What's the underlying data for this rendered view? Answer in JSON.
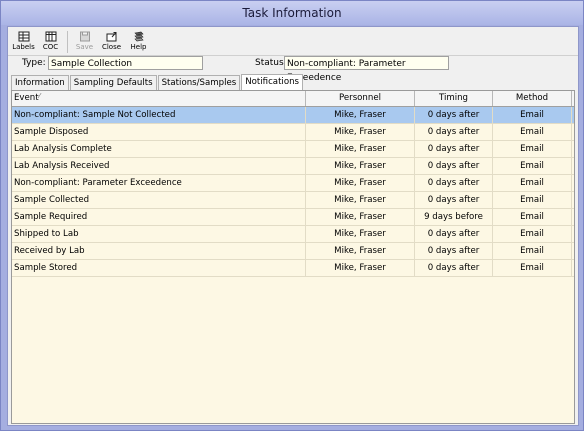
{
  "window": {
    "title": "Task Information"
  },
  "toolbar": {
    "buttons": [
      {
        "label": "Labels",
        "icon": "labels-icon",
        "enabled": true
      },
      {
        "label": "COC",
        "icon": "coc-icon",
        "enabled": true
      },
      {
        "label": "Save",
        "icon": "save-icon",
        "enabled": false
      },
      {
        "label": "Close",
        "icon": "close-icon",
        "enabled": true
      },
      {
        "label": "Help",
        "icon": "help-icon",
        "enabled": true
      }
    ]
  },
  "form": {
    "type_label": "Type:",
    "type_value": "Sample Collection",
    "status_label": "Status:",
    "status_value": "Non-compliant: Parameter Exceedence"
  },
  "tabs": [
    {
      "label": "Information",
      "active": false
    },
    {
      "label": "Sampling Defaults",
      "active": false
    },
    {
      "label": "Stations/Samples",
      "active": false
    },
    {
      "label": "Notifications",
      "active": true
    }
  ],
  "grid": {
    "columns": [
      "Event",
      "Personnel",
      "Timing",
      "Method"
    ],
    "rows": [
      {
        "event": "Non-compliant: Sample Not Collected",
        "personnel": "Mike, Fraser",
        "timing": "0 days after",
        "method": "Email",
        "selected": true
      },
      {
        "event": "Sample Disposed",
        "personnel": "Mike, Fraser",
        "timing": "0 days after",
        "method": "Email",
        "selected": false
      },
      {
        "event": "Lab Analysis Complete",
        "personnel": "Mike, Fraser",
        "timing": "0 days after",
        "method": "Email",
        "selected": false
      },
      {
        "event": "Lab Analysis Received",
        "personnel": "Mike, Fraser",
        "timing": "0 days after",
        "method": "Email",
        "selected": false
      },
      {
        "event": "Non-compliant: Parameter Exceedence",
        "personnel": "Mike, Fraser",
        "timing": "0 days after",
        "method": "Email",
        "selected": false
      },
      {
        "event": "Sample Collected",
        "personnel": "Mike, Fraser",
        "timing": "0 days after",
        "method": "Email",
        "selected": false
      },
      {
        "event": "Sample Required",
        "personnel": "Mike, Fraser",
        "timing": "9 days before",
        "method": "Email",
        "selected": false
      },
      {
        "event": "Shipped to Lab",
        "personnel": "Mike, Fraser",
        "timing": "0 days after",
        "method": "Email",
        "selected": false
      },
      {
        "event": "Received by Lab",
        "personnel": "Mike, Fraser",
        "timing": "0 days after",
        "method": "Email",
        "selected": false
      },
      {
        "event": "Sample Stored",
        "personnel": "Mike, Fraser",
        "timing": "0 days after",
        "method": "Email",
        "selected": false
      }
    ]
  },
  "colors": {
    "title_bar": "#aab4e6",
    "grid_background": "#fdf8e4",
    "selected_row": "#a9c9ef",
    "field_background": "#fffff0"
  }
}
